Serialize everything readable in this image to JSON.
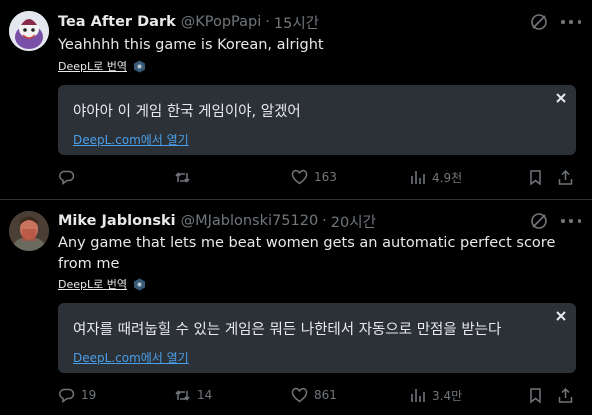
{
  "tweets": [
    {
      "name": "Tea After Dark",
      "handle": "@KPopPapi",
      "separator": "·",
      "time": "15시간",
      "text": "Yeahhhh this game is Korean, alright",
      "deepl_label": "DeepL로 번역",
      "translation": "야아아 이 게임 한국 게임이야, 알겠어",
      "open_link": "DeepL.com에서 열기",
      "replies": "",
      "retweets": "",
      "likes": "163",
      "views": "4.9천"
    },
    {
      "name": "Mike Jablonski",
      "handle": "@MJablonski75120",
      "separator": "·",
      "time": "20시간",
      "text": "Any game that lets me beat women gets an automatic perfect score from me",
      "deepl_label": "DeepL로 번역",
      "translation": "여자를 때려눕힐 수 있는 게임은 뭐든 나한테서 자동으로 만점을 받는다",
      "open_link": "DeepL.com에서 열기",
      "replies": "19",
      "retweets": "14",
      "likes": "861",
      "views": "3.4만"
    }
  ],
  "colors": {
    "background": "#000000",
    "text": "#e7e9ea",
    "muted": "#71767b",
    "translation_box": "#2c3138",
    "link": "#4a9ee8"
  },
  "icons": [
    "grok-icon",
    "more-icon",
    "deepl-icon",
    "close-icon",
    "reply-icon",
    "retweet-icon",
    "like-icon",
    "views-icon",
    "bookmark-icon",
    "share-icon"
  ]
}
